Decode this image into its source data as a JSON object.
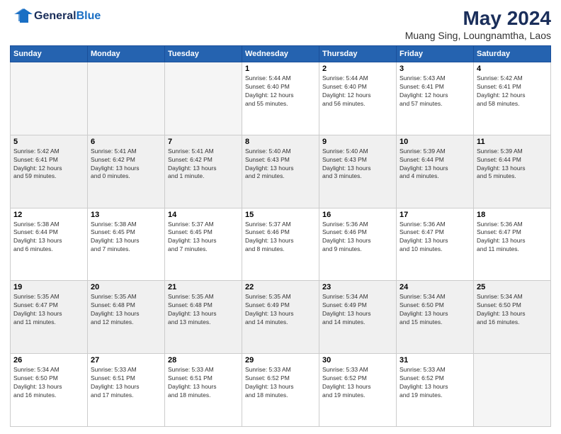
{
  "logo": {
    "general": "General",
    "blue": "Blue"
  },
  "header": {
    "title": "May 2024",
    "location": "Muang Sing, Loungnamtha, Laos"
  },
  "weekdays": [
    "Sunday",
    "Monday",
    "Tuesday",
    "Wednesday",
    "Thursday",
    "Friday",
    "Saturday"
  ],
  "weeks": [
    [
      {
        "day": "",
        "empty": true
      },
      {
        "day": "",
        "empty": true
      },
      {
        "day": "",
        "empty": true
      },
      {
        "day": "1",
        "info": "Sunrise: 5:44 AM\nSunset: 6:40 PM\nDaylight: 12 hours\nand 55 minutes."
      },
      {
        "day": "2",
        "info": "Sunrise: 5:44 AM\nSunset: 6:40 PM\nDaylight: 12 hours\nand 56 minutes."
      },
      {
        "day": "3",
        "info": "Sunrise: 5:43 AM\nSunset: 6:41 PM\nDaylight: 12 hours\nand 57 minutes."
      },
      {
        "day": "4",
        "info": "Sunrise: 5:42 AM\nSunset: 6:41 PM\nDaylight: 12 hours\nand 58 minutes."
      }
    ],
    [
      {
        "day": "5",
        "info": "Sunrise: 5:42 AM\nSunset: 6:41 PM\nDaylight: 12 hours\nand 59 minutes."
      },
      {
        "day": "6",
        "info": "Sunrise: 5:41 AM\nSunset: 6:42 PM\nDaylight: 13 hours\nand 0 minutes."
      },
      {
        "day": "7",
        "info": "Sunrise: 5:41 AM\nSunset: 6:42 PM\nDaylight: 13 hours\nand 1 minute."
      },
      {
        "day": "8",
        "info": "Sunrise: 5:40 AM\nSunset: 6:43 PM\nDaylight: 13 hours\nand 2 minutes."
      },
      {
        "day": "9",
        "info": "Sunrise: 5:40 AM\nSunset: 6:43 PM\nDaylight: 13 hours\nand 3 minutes."
      },
      {
        "day": "10",
        "info": "Sunrise: 5:39 AM\nSunset: 6:44 PM\nDaylight: 13 hours\nand 4 minutes."
      },
      {
        "day": "11",
        "info": "Sunrise: 5:39 AM\nSunset: 6:44 PM\nDaylight: 13 hours\nand 5 minutes."
      }
    ],
    [
      {
        "day": "12",
        "info": "Sunrise: 5:38 AM\nSunset: 6:44 PM\nDaylight: 13 hours\nand 6 minutes."
      },
      {
        "day": "13",
        "info": "Sunrise: 5:38 AM\nSunset: 6:45 PM\nDaylight: 13 hours\nand 7 minutes."
      },
      {
        "day": "14",
        "info": "Sunrise: 5:37 AM\nSunset: 6:45 PM\nDaylight: 13 hours\nand 7 minutes."
      },
      {
        "day": "15",
        "info": "Sunrise: 5:37 AM\nSunset: 6:46 PM\nDaylight: 13 hours\nand 8 minutes."
      },
      {
        "day": "16",
        "info": "Sunrise: 5:36 AM\nSunset: 6:46 PM\nDaylight: 13 hours\nand 9 minutes."
      },
      {
        "day": "17",
        "info": "Sunrise: 5:36 AM\nSunset: 6:47 PM\nDaylight: 13 hours\nand 10 minutes."
      },
      {
        "day": "18",
        "info": "Sunrise: 5:36 AM\nSunset: 6:47 PM\nDaylight: 13 hours\nand 11 minutes."
      }
    ],
    [
      {
        "day": "19",
        "info": "Sunrise: 5:35 AM\nSunset: 6:47 PM\nDaylight: 13 hours\nand 11 minutes."
      },
      {
        "day": "20",
        "info": "Sunrise: 5:35 AM\nSunset: 6:48 PM\nDaylight: 13 hours\nand 12 minutes."
      },
      {
        "day": "21",
        "info": "Sunrise: 5:35 AM\nSunset: 6:48 PM\nDaylight: 13 hours\nand 13 minutes."
      },
      {
        "day": "22",
        "info": "Sunrise: 5:35 AM\nSunset: 6:49 PM\nDaylight: 13 hours\nand 14 minutes."
      },
      {
        "day": "23",
        "info": "Sunrise: 5:34 AM\nSunset: 6:49 PM\nDaylight: 13 hours\nand 14 minutes."
      },
      {
        "day": "24",
        "info": "Sunrise: 5:34 AM\nSunset: 6:50 PM\nDaylight: 13 hours\nand 15 minutes."
      },
      {
        "day": "25",
        "info": "Sunrise: 5:34 AM\nSunset: 6:50 PM\nDaylight: 13 hours\nand 16 minutes."
      }
    ],
    [
      {
        "day": "26",
        "info": "Sunrise: 5:34 AM\nSunset: 6:50 PM\nDaylight: 13 hours\nand 16 minutes."
      },
      {
        "day": "27",
        "info": "Sunrise: 5:33 AM\nSunset: 6:51 PM\nDaylight: 13 hours\nand 17 minutes."
      },
      {
        "day": "28",
        "info": "Sunrise: 5:33 AM\nSunset: 6:51 PM\nDaylight: 13 hours\nand 18 minutes."
      },
      {
        "day": "29",
        "info": "Sunrise: 5:33 AM\nSunset: 6:52 PM\nDaylight: 13 hours\nand 18 minutes."
      },
      {
        "day": "30",
        "info": "Sunrise: 5:33 AM\nSunset: 6:52 PM\nDaylight: 13 hours\nand 19 minutes."
      },
      {
        "day": "31",
        "info": "Sunrise: 5:33 AM\nSunset: 6:52 PM\nDaylight: 13 hours\nand 19 minutes."
      },
      {
        "day": "",
        "empty": true
      }
    ]
  ]
}
